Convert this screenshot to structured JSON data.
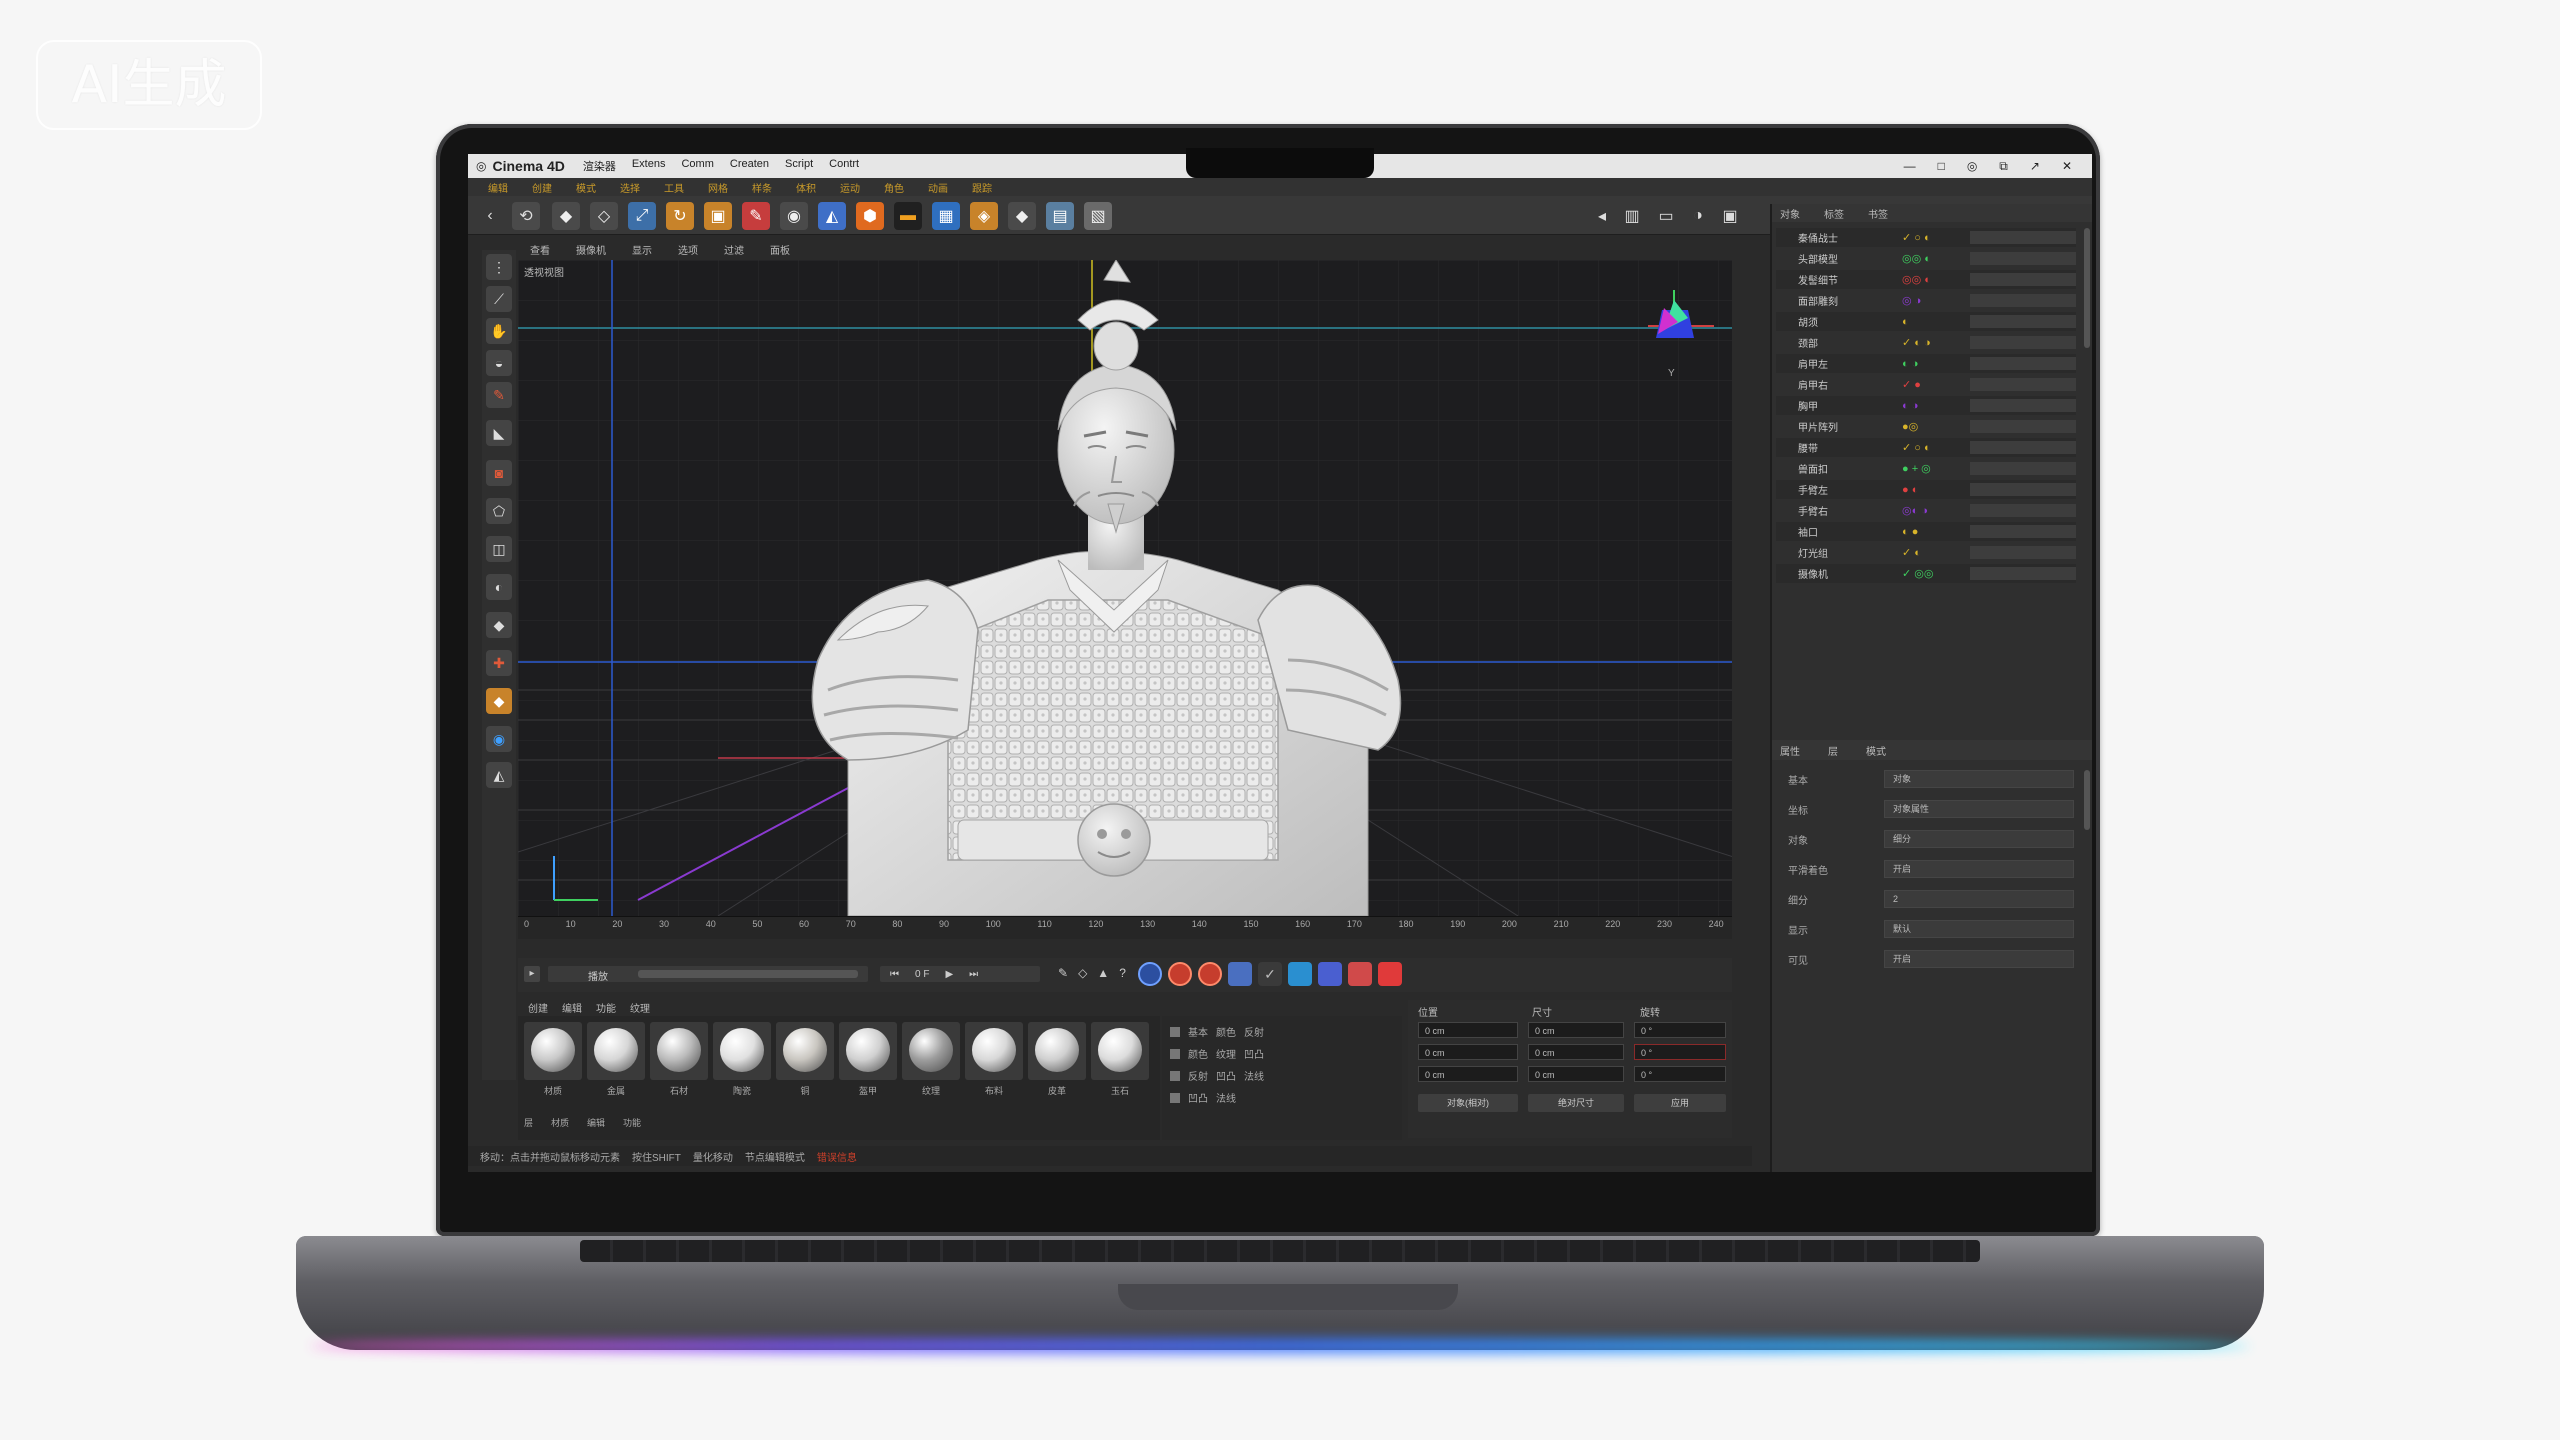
{
  "watermark": "AI生成",
  "app": {
    "title": "Cinema 4D",
    "menus": [
      "渲染器",
      "Extens",
      "Comm",
      "Createn",
      "Script",
      "Contrt"
    ],
    "window_buttons": [
      "—",
      "□",
      "◎",
      "⧉",
      "↗",
      "✕"
    ],
    "menu2": [
      "编辑",
      "创建",
      "模式",
      "选择",
      "工具",
      "网格",
      "样条",
      "体积",
      "运动",
      "角色",
      "动画",
      "跟踪"
    ]
  },
  "viewport": {
    "tabs": [
      "查看",
      "摄像机",
      "显示",
      "选项",
      "过滤",
      "面板"
    ],
    "label": "透视视图",
    "gizmo_label": "Y",
    "tl_numbers": [
      "0",
      "10",
      "20",
      "30",
      "40",
      "50",
      "60",
      "70",
      "80",
      "90",
      "100",
      "110",
      "120",
      "130",
      "140",
      "150",
      "160",
      "170",
      "180",
      "190",
      "200",
      "210",
      "220",
      "230",
      "240"
    ]
  },
  "transport": {
    "field_label": "播放",
    "frame": "0 F"
  },
  "materials": {
    "tabs": [
      "创建",
      "编辑",
      "功能",
      "纹理"
    ],
    "items": [
      {
        "label": "材质",
        "color": "#c9c9c9"
      },
      {
        "label": "金属",
        "color": "#d6d6d6"
      },
      {
        "label": "石材",
        "color": "#bbbbbb"
      },
      {
        "label": "陶瓷",
        "color": "#e0e0e0"
      },
      {
        "label": "铜",
        "color": "#c9c6c0"
      },
      {
        "label": "盔甲",
        "color": "#d0d0d0"
      },
      {
        "label": "纹理",
        "color": "#9d9d9d"
      },
      {
        "label": "布料",
        "color": "#d8d8d8"
      },
      {
        "label": "皮革",
        "color": "#cfcfcf"
      },
      {
        "label": "玉石",
        "color": "#dcdcdc"
      }
    ],
    "footer": [
      "层",
      "材质",
      "编辑",
      "功能"
    ]
  },
  "material_attrs": [
    {
      "a": "基本",
      "b": "颜色",
      "c": "反射"
    },
    {
      "a": "颜色",
      "b": "纹理",
      "c": "凹凸"
    },
    {
      "a": "反射",
      "b": "凹凸",
      "c": "法线"
    },
    {
      "a": "凹凸",
      "b": "法线",
      "c": ""
    }
  ],
  "coords": {
    "headers": [
      "位置",
      "尺寸",
      "旋转"
    ],
    "x": [
      "0 cm",
      "0 cm",
      "0 °"
    ],
    "y": [
      "0 cm",
      "0 cm",
      "0 °"
    ],
    "z": [
      "0 cm",
      "0 cm",
      "0 °"
    ],
    "buttons": [
      "对象(相对)",
      "绝对尺寸",
      "应用"
    ]
  },
  "status": {
    "items": [
      "移动：点击并拖动鼠标移动元素",
      "按住SHIFT",
      "量化移动",
      "节点编辑模式"
    ],
    "error": "错误信息"
  },
  "object_manager": {
    "header": [
      "对象",
      "标签",
      "书签"
    ],
    "rows": [
      {
        "name": "秦俑战士",
        "tags": "✓ ○ ◐"
      },
      {
        "name": "头部模型",
        "tags": "◎◎ ◐"
      },
      {
        "name": "发髻细节",
        "tags": "◎◎ ◐"
      },
      {
        "name": "面部雕刻",
        "tags": "◎ ◑"
      },
      {
        "name": "胡须",
        "tags": "◐"
      },
      {
        "name": "颈部",
        "tags": "✓ ◐ ◑"
      },
      {
        "name": "肩甲左",
        "tags": "◐ ◑"
      },
      {
        "name": "肩甲右",
        "tags": "✓ ●"
      },
      {
        "name": "胸甲",
        "tags": "◐ ◑"
      },
      {
        "name": "甲片阵列",
        "tags": "●◎"
      },
      {
        "name": "腰带",
        "tags": "✓ ○ ◐"
      },
      {
        "name": "兽面扣",
        "tags": "● + ◎"
      },
      {
        "name": "手臂左",
        "tags": "● ◐"
      },
      {
        "name": "手臂右",
        "tags": "◎◐ ◑"
      },
      {
        "name": "袖口",
        "tags": "◐ ●"
      },
      {
        "name": "灯光组",
        "tags": "✓ ◐"
      },
      {
        "name": "摄像机",
        "tags": "✓ ◎◎"
      }
    ]
  },
  "attributes": {
    "header": [
      "属性",
      "层",
      "模式"
    ],
    "rows": [
      {
        "label": "基本",
        "value": "对象"
      },
      {
        "label": "坐标",
        "value": "对象属性"
      },
      {
        "label": "对象",
        "value": "细分"
      },
      {
        "label": "平滑着色",
        "value": "开启"
      },
      {
        "label": "细分",
        "value": "2"
      },
      {
        "label": "显示",
        "value": "默认"
      },
      {
        "label": "可见",
        "value": "开启"
      }
    ]
  }
}
